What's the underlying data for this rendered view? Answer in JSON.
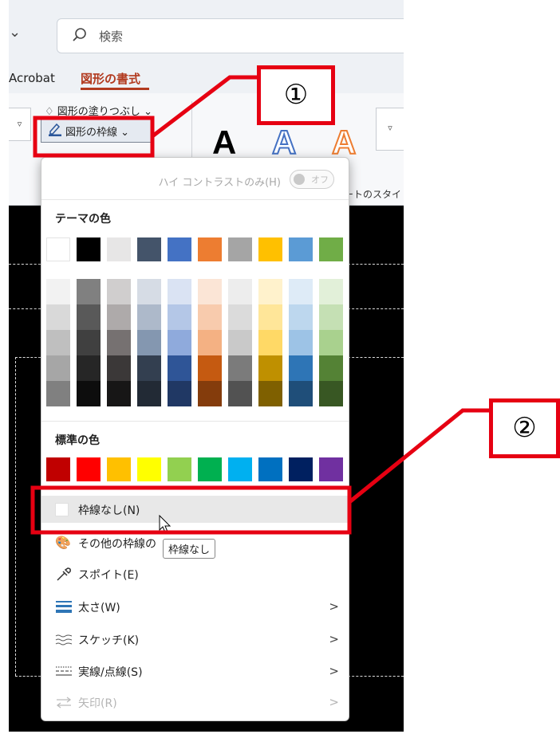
{
  "search": {
    "placeholder": "検索"
  },
  "tabs": {
    "acrobat": "Acrobat",
    "shape_format": "図形の書式"
  },
  "ribbon": {
    "shape_fill_label": "図形の塗りつぶし",
    "shape_outline_label": "図形の枠線",
    "wordart_letter": "A",
    "style_group_label": "ートのスタイ"
  },
  "menu": {
    "high_contrast_label": "ハイ コントラストのみ(H)",
    "high_contrast_state": "オフ",
    "theme_colors_label": "テーマの色",
    "standard_colors_label": "標準の色",
    "items": [
      {
        "label": "枠線なし(N)",
        "icon": "no-outline-swatch",
        "state": "hover"
      },
      {
        "label": "その他の枠線の",
        "icon": "palette-icon"
      },
      {
        "label": "スポイト(E)",
        "icon": "eyedropper-icon"
      },
      {
        "label": "太さ(W)",
        "icon": "line-weight-icon",
        "submenu": ">"
      },
      {
        "label": "スケッチ(K)",
        "icon": "sketch-icon",
        "submenu": ">"
      },
      {
        "label": "実線/点線(S)",
        "icon": "dash-icon",
        "submenu": ">"
      },
      {
        "label": "矢印(R)",
        "icon": "arrows-icon",
        "submenu": ">",
        "disabled": true
      }
    ],
    "tooltip": "枠線なし"
  },
  "colors": {
    "theme_top": [
      "#FFFFFF",
      "#000000",
      "#E7E6E6",
      "#44546A",
      "#4472C4",
      "#ED7D31",
      "#A5A5A5",
      "#FFC000",
      "#5B9BD5",
      "#70AD47"
    ],
    "theme_shades": [
      [
        "#F2F2F2",
        "#D9D9D9",
        "#BFBFBF",
        "#A6A6A6",
        "#808080"
      ],
      [
        "#808080",
        "#595959",
        "#404040",
        "#262626",
        "#0D0D0D"
      ],
      [
        "#D0CECE",
        "#AEAAAA",
        "#767171",
        "#3B3838",
        "#171616"
      ],
      [
        "#D6DCE5",
        "#ADB9CA",
        "#8497B0",
        "#333F50",
        "#222A35"
      ],
      [
        "#DAE3F3",
        "#B4C7E7",
        "#8FAADC",
        "#2F5597",
        "#203864"
      ],
      [
        "#FBE5D6",
        "#F8CBAD",
        "#F4B183",
        "#C55A11",
        "#843C0C"
      ],
      [
        "#EDEDED",
        "#DBDBDB",
        "#C9C9C9",
        "#7B7B7B",
        "#525252"
      ],
      [
        "#FFF2CC",
        "#FFE699",
        "#FFD966",
        "#BF9000",
        "#7F6000"
      ],
      [
        "#DEEBF7",
        "#BDD7EE",
        "#9DC3E6",
        "#2E75B6",
        "#1F4E79"
      ],
      [
        "#E2F0D9",
        "#C5E0B4",
        "#A9D18E",
        "#548235",
        "#385723"
      ]
    ],
    "standard": [
      "#C00000",
      "#FF0000",
      "#FFC000",
      "#FFFF00",
      "#92D050",
      "#00B050",
      "#00B0F0",
      "#0070C0",
      "#002060",
      "#7030A0"
    ],
    "accent_red": "#E60012",
    "tab_accent": "#B23A1F"
  },
  "callouts": [
    {
      "label": "①"
    },
    {
      "label": "②"
    }
  ]
}
